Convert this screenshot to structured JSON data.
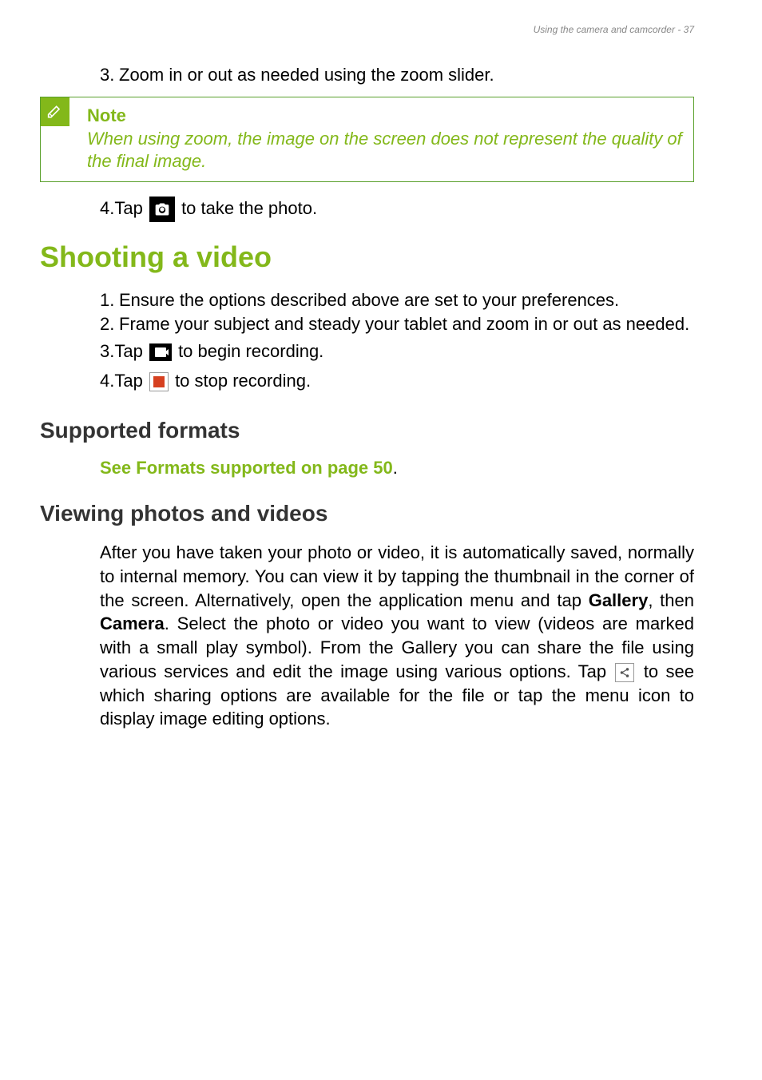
{
  "header": "Using the camera and camcorder - 37",
  "step3": {
    "num": "3.",
    "text": "Zoom in or out as needed using the zoom slider."
  },
  "note": {
    "title": "Note",
    "body": "When using zoom, the image on the screen does not represent the quality of the final image."
  },
  "step4": {
    "num": "4.",
    "before": "Tap ",
    "after": " to take the photo."
  },
  "h1": "Shooting a video",
  "video": {
    "s1": {
      "num": "1.",
      "text": "Ensure the options described above are set to your preferences."
    },
    "s2": {
      "num": "2.",
      "text": "Frame your subject and steady your tablet and zoom in or out as needed."
    },
    "s3": {
      "num": "3.",
      "before": "Tap ",
      "after": " to begin recording."
    },
    "s4": {
      "num": "4.",
      "before": "Tap ",
      "after": " to stop recording."
    }
  },
  "supported": {
    "heading": "Supported formats",
    "link_text": "See Formats supported on page 50",
    "period": "."
  },
  "viewing": {
    "heading": "Viewing photos and videos",
    "p1a": "After you have taken your photo or video, it is automatically saved, normally to internal memory. You can view it by tapping the thumbnail in the corner of the screen. Alternatively, open the application menu and tap ",
    "gallery": "Gallery",
    "p1b": ", then ",
    "camera": "Camera",
    "p1c": ". Select the photo or video you want to view (videos are marked with a small play symbol). From the Gallery you can share the file using various services and edit the image using various options. Tap ",
    "p1d": " to see which sharing options are available for the file or tap the menu icon to display image editing options."
  }
}
